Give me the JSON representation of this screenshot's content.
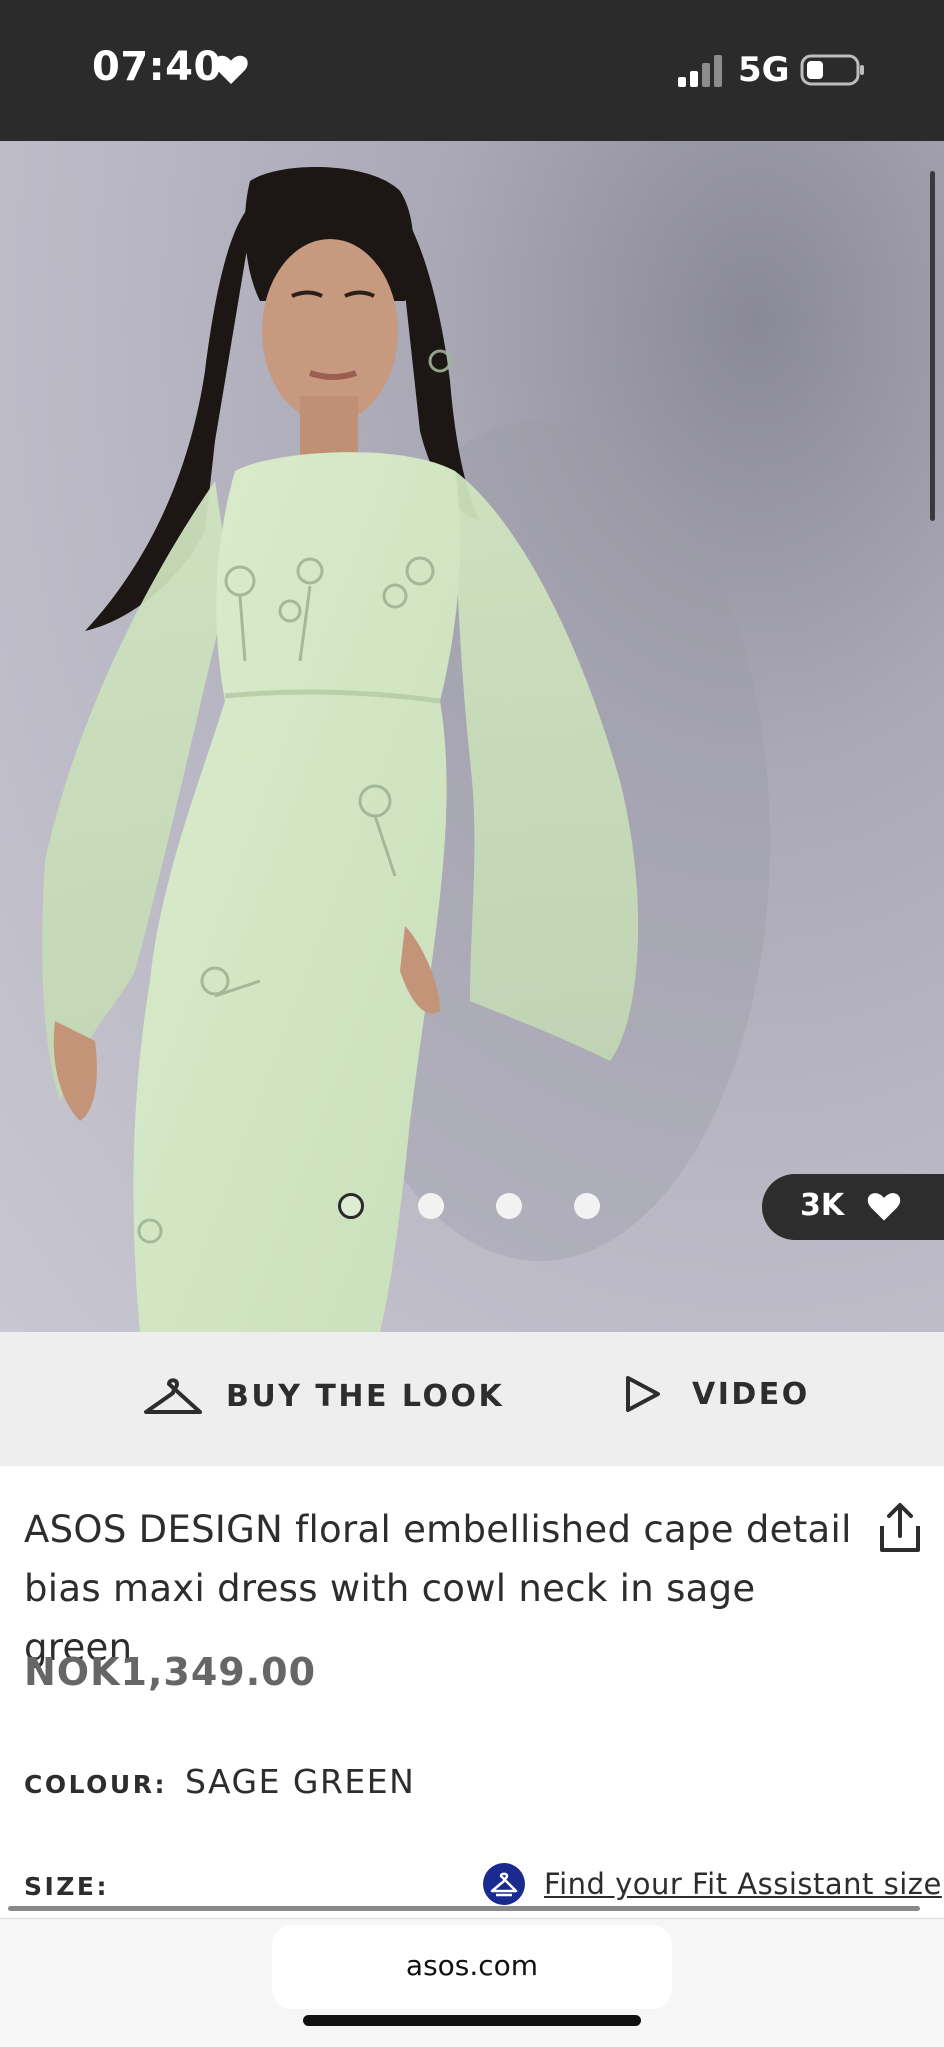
{
  "status_bar": {
    "time": "07:40",
    "network": "5G",
    "icons": [
      "heart-icon",
      "signal-icon",
      "battery-icon"
    ]
  },
  "gallery": {
    "image_count": 4,
    "active_index": 0,
    "saves_count": "3K",
    "saves_icon": "heart-icon"
  },
  "actions": {
    "buy_the_look": "BUY THE LOOK",
    "video": "VIDEO"
  },
  "product": {
    "title": "ASOS DESIGN floral embellished cape detail bias maxi dress with cowl neck in sage green",
    "price": "NOK1,349.00",
    "colour_label": "COLOUR:",
    "colour_value": "SAGE GREEN",
    "size_label": "SIZE:",
    "fit_assistant_link": "Find your Fit Assistant size"
  },
  "browser": {
    "url": "asos.com"
  },
  "colors": {
    "status_bar_bg": "#2b2b2b",
    "action_bar_bg": "#eeeeee",
    "price_text": "#666666",
    "dress_sage": "#d4e7c6",
    "fit_icon_blue": "#1a2b8f"
  }
}
